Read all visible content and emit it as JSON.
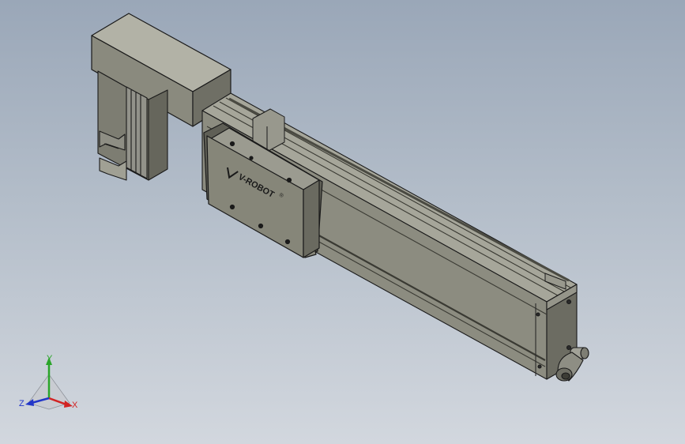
{
  "viewport": {
    "background_top": "#9aa7b8",
    "background_bottom": "#d2d7de"
  },
  "model": {
    "body_color": "#8a8a7e",
    "body_light": "#a4a498",
    "body_dark": "#5e5e55",
    "edge_color": "#1a1a1a",
    "carriage_logo": "V-ROBOT",
    "logo_mark": "®"
  },
  "triad": {
    "x_label": "X",
    "y_label": "Y",
    "z_label": "Z",
    "x_color": "#d22323",
    "y_color": "#2aa52a",
    "z_color": "#2236c9"
  }
}
